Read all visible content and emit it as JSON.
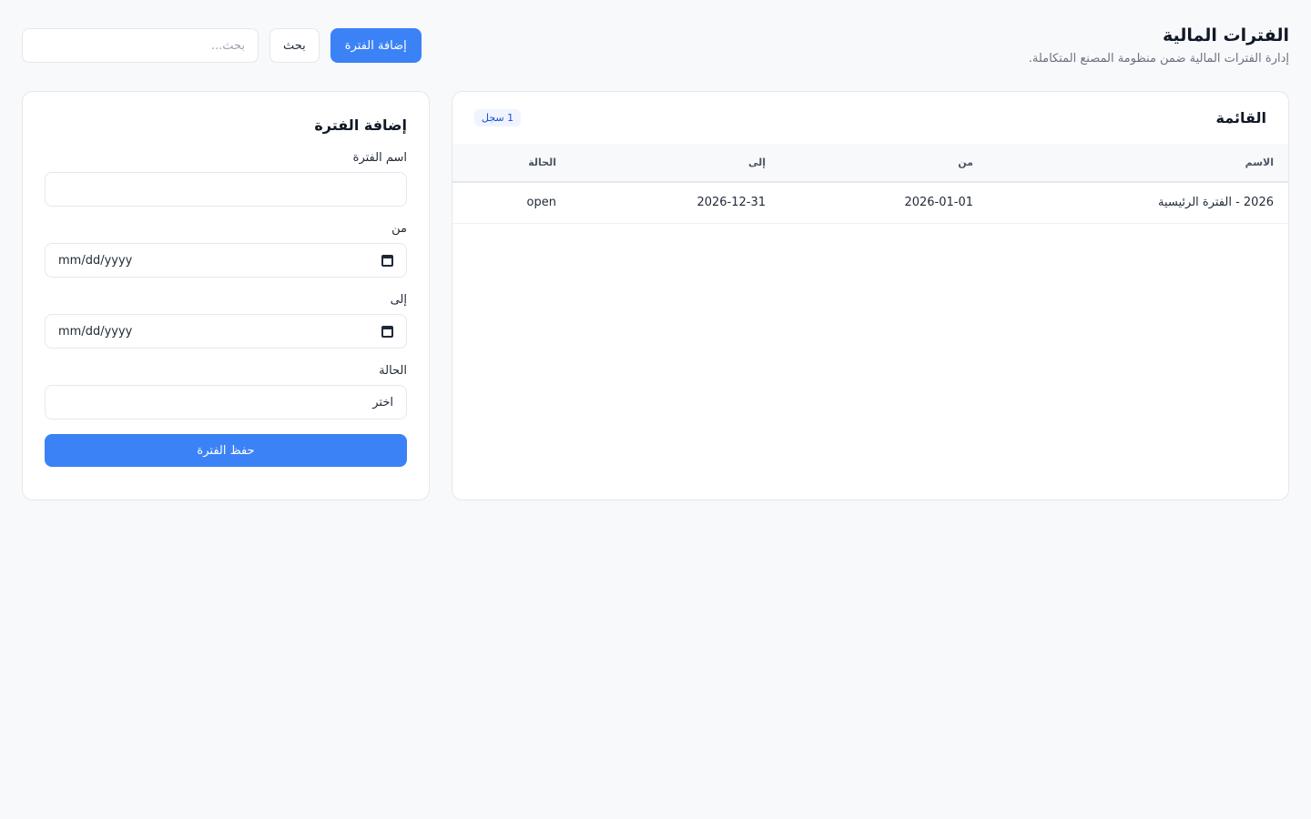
{
  "header": {
    "title": "الفترات المالية",
    "subtitle": "إدارة الفترات المالية ضمن منظومة المصنع المتكاملة."
  },
  "toolbar": {
    "search_placeholder": "بحث...",
    "search_value": "",
    "search_button": "بحث",
    "add_button": "إضافة الفترة"
  },
  "list": {
    "title": "القائمة",
    "count_badge": "1 سجل",
    "columns": [
      "الاسم",
      "من",
      "إلى",
      "الحالة"
    ],
    "rows": [
      {
        "name": "2026 - الفترة الرئيسية",
        "from": "2026-01-01",
        "to": "2026-12-31",
        "status": "open"
      }
    ]
  },
  "form": {
    "title": "إضافة الفترة",
    "name_label": "اسم الفترة",
    "name_value": "",
    "from_label": "من",
    "from_value": "mm/dd/yyyy",
    "to_label": "إلى",
    "to_value": "mm/dd/yyyy",
    "status_label": "الحالة",
    "status_value": "اختر",
    "save_button": "حفظ الفترة"
  },
  "colors": {
    "primary": "#3b82f6",
    "background": "#f8f9fb",
    "border": "#e5e7eb",
    "badge_bg": "#eff4ff"
  }
}
